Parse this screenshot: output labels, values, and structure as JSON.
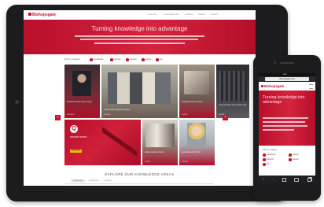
{
  "site": {
    "logo": "Bishopsgate",
    "logo_sub": "xxx",
    "nav_links": [
      "xxxxx xxx",
      "xxxxxxxxxxxx xxx",
      "xxxxxxxx",
      "xxxxxxx",
      "xxxxxxx"
    ]
  },
  "hero": {
    "title": "Turning knowledge into advantage"
  },
  "filters": {
    "label": "Filter by category",
    "items": [
      "xxxxxxxxxx",
      "xxxxxxx",
      "xxxxxxx",
      "xxxxxx",
      "xxx"
    ]
  },
  "cards": [
    {
      "caption": "xxxxxxx xxxxx xxxx xxxxx",
      "category": "xxxxxxxx"
    },
    {
      "caption": "xxxxx xxxx xxxxxxx xxxxxx",
      "category": "xxxxxxx"
    },
    {
      "caption": "xxxxxxxxx xxxx xxxxx",
      "category": "xxxxxx"
    },
    {
      "caption": "xxxx xxxxxxx xxxx xxxxx xxx",
      "category": "xxxxxx"
    },
    {
      "caption": "xxxxx xxxxxx xxxxx",
      "category": "xxxxxx"
    },
    {
      "caption": "xxxxxxxx xxxx xxxx",
      "category": "xxxxxxx"
    }
  ],
  "featured": {
    "badge": "Q",
    "title": "xxxxxxx xxxxx",
    "button": "xxxx xxxx"
  },
  "arrows": {
    "prev": "‹",
    "next": "›"
  },
  "explore": {
    "title": "EXPLORE OUR KNOWLEDGE AREAS",
    "tabs": [
      "Intellectual",
      "xxxxxxxxxx",
      "xxxxxxx"
    ]
  },
  "phone": {
    "status": "xxxx",
    "url": "bishopsgate.com",
    "logo": "Bishopsgate",
    "hero_title": "Turning knowledge into advantage",
    "filter_label": "Filter by category",
    "filter_items": [
      "xxxxxxxxxx",
      "xxxxxxx",
      "xxxxxxxx",
      "xxxxxxx",
      "xxx"
    ],
    "nav_icons": [
      "back-icon",
      "forward-icon",
      "share-icon",
      "bookmark-icon",
      "tabs-icon"
    ]
  },
  "colors": {
    "brand_red": "#c8102e",
    "device_body": "#1c1c1e"
  }
}
